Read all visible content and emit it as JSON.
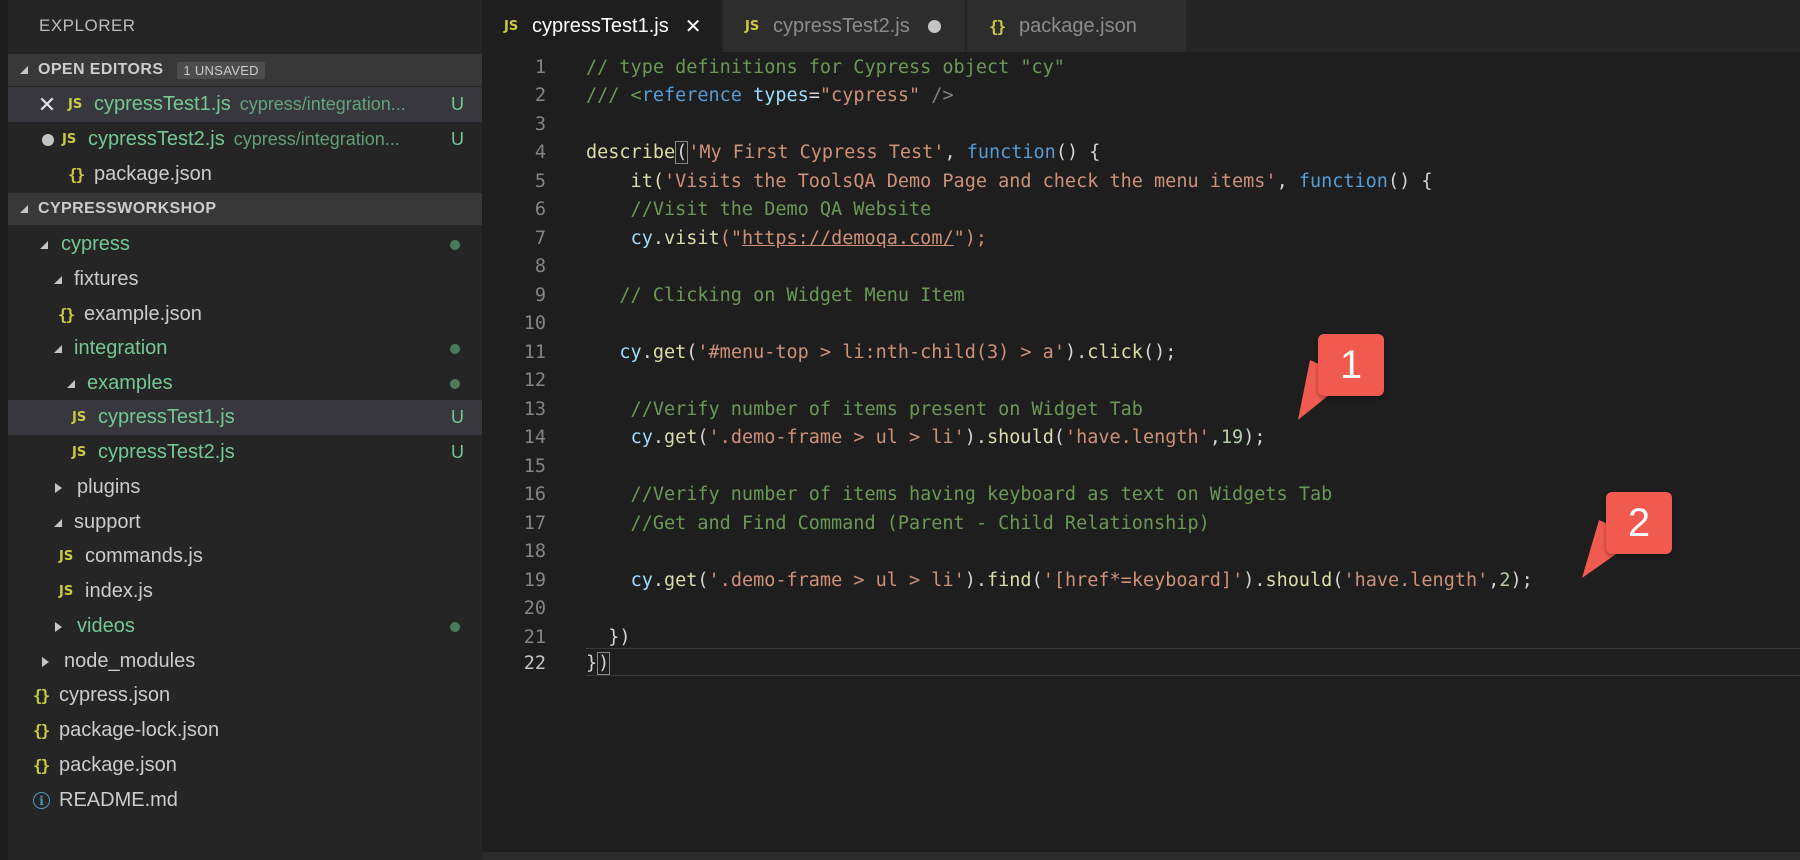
{
  "explorer": {
    "title": "EXPLORER",
    "open_editors": {
      "label": "OPEN EDITORS",
      "badge": "1 UNSAVED",
      "items": [
        {
          "name": "cypressTest1.js",
          "desc": "cypress/integration...",
          "status": "U"
        },
        {
          "name": "cypressTest2.js",
          "desc": "cypress/integration...",
          "status": "U"
        },
        {
          "name": "package.json"
        }
      ]
    },
    "workspace": {
      "label": "CYPRESSWORKSHOP",
      "tree": [
        "cypress",
        "fixtures",
        "example.json",
        "integration",
        "examples",
        "cypressTest1.js",
        "cypressTest2.js",
        "plugins",
        "support",
        "commands.js",
        "index.js",
        "videos",
        "node_modules",
        "cypress.json",
        "package-lock.json",
        "package.json",
        "README.md"
      ],
      "status_u": "U"
    }
  },
  "tabs": [
    {
      "label": "cypressTest1.js",
      "icon": "js-icon",
      "active": true
    },
    {
      "label": "cypressTest2.js",
      "icon": "js-icon",
      "dirty": true
    },
    {
      "label": "package.json",
      "icon": "json-icon"
    }
  ],
  "editor": {
    "line_numbers": [
      "1",
      "2",
      "3",
      "4",
      "5",
      "6",
      "7",
      "8",
      "9",
      "10",
      "11",
      "12",
      "13",
      "14",
      "15",
      "16",
      "17",
      "18",
      "19",
      "20",
      "21",
      "22"
    ],
    "code": {
      "l1": "// type definitions for Cypress object \"cy\"",
      "l2a": "/// <",
      "l2b": "reference",
      "l2c": " types",
      "l2d": "=",
      "l2e": "\"cypress\"",
      "l2f": " />",
      "l4a": "describe",
      "l4b": "(",
      "l4c": "'My First Cypress Test'",
      "l4d": ", ",
      "l4e": "function",
      "l4f": "() {",
      "l5a": "    it(",
      "l5b": "'Visits the ToolsQA Demo Page and check the menu items'",
      "l5c": ", ",
      "l5d": "function",
      "l5e": "() {",
      "l6": "    //Visit the Demo QA Website",
      "l7a": "    ",
      "l7b": "cy",
      "l7c": ".",
      "l7d": "visit",
      "l7e": "(\"",
      "l7f": "https://demoqa.com/",
      "l7g": "\");",
      "l9": "   // Clicking on Widget Menu Item",
      "l11a": "   ",
      "l11b": "cy",
      "l11c": ".",
      "l11d": "get",
      "l11e": "(",
      "l11f": "'#menu-top > li:nth-child(3) > a'",
      "l11g": ").",
      "l11h": "click",
      "l11i": "();",
      "l13": "    //Verify number of items present on Widget Tab",
      "l14a": "    ",
      "l14b": "cy",
      "l14c": ".",
      "l14d": "get",
      "l14e": "(",
      "l14f": "'.demo-frame > ul > li'",
      "l14g": ").",
      "l14h": "should",
      "l14i": "(",
      "l14j": "'have.length'",
      "l14k": ",",
      "l14l": "19",
      "l14m": ");",
      "l16": "    //Verify number of items having keyboard as text on Widgets Tab",
      "l17": "    //Get and Find Command (Parent - Child Relationship)",
      "l19a": "    ",
      "l19b": "cy",
      "l19c": ".",
      "l19d": "get",
      "l19e": "(",
      "l19f": "'.demo-frame > ul > li'",
      "l19g": ").",
      "l19h": "find",
      "l19i": "(",
      "l19j": "'[href*=keyboard]'",
      "l19k": ").",
      "l19l": "should",
      "l19m": "(",
      "l19n": "'have.length'",
      "l19o": ",",
      "l19p": "2",
      "l19q": ");",
      "l21": "  })",
      "l22a": "}",
      "l22b": ")"
    }
  },
  "callouts": [
    "1",
    "2"
  ],
  "colors": {
    "comment": "#6a9955",
    "string": "#ce9178",
    "function": "#dcdcaa",
    "keyword": "#569cd6",
    "variable": "#9cdcfe",
    "number": "#b5cea8",
    "git_untracked": "#73c991",
    "callout": "#f15b4f"
  }
}
